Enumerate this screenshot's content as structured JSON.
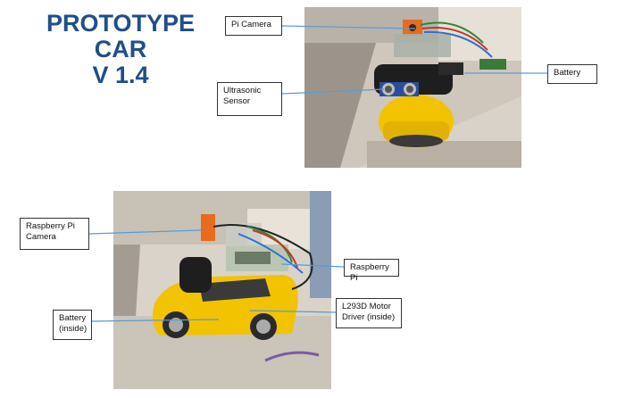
{
  "title": {
    "line1": "PROTOTYPE",
    "line2": "CAR",
    "line3": "V 1.4"
  },
  "photo1": {
    "labels": {
      "pi_camera": "Pi Camera",
      "ultrasonic_line1": "Ultrasonic",
      "ultrasonic_line2": "Sensor",
      "battery": "Battery"
    }
  },
  "photo2": {
    "labels": {
      "raspberry_cam_line1": "Raspberry Pi",
      "raspberry_cam_line2": "Camera",
      "raspberry_pi": "Raspberry Pi",
      "battery_line1": "Battery",
      "battery_line2": "(inside)",
      "motor_line1": "L293D Motor",
      "motor_line2": "Driver (inside)"
    }
  },
  "colors": {
    "title": "#1f4e8c",
    "leader": "#5b9bd5",
    "car": "#f2c300"
  }
}
